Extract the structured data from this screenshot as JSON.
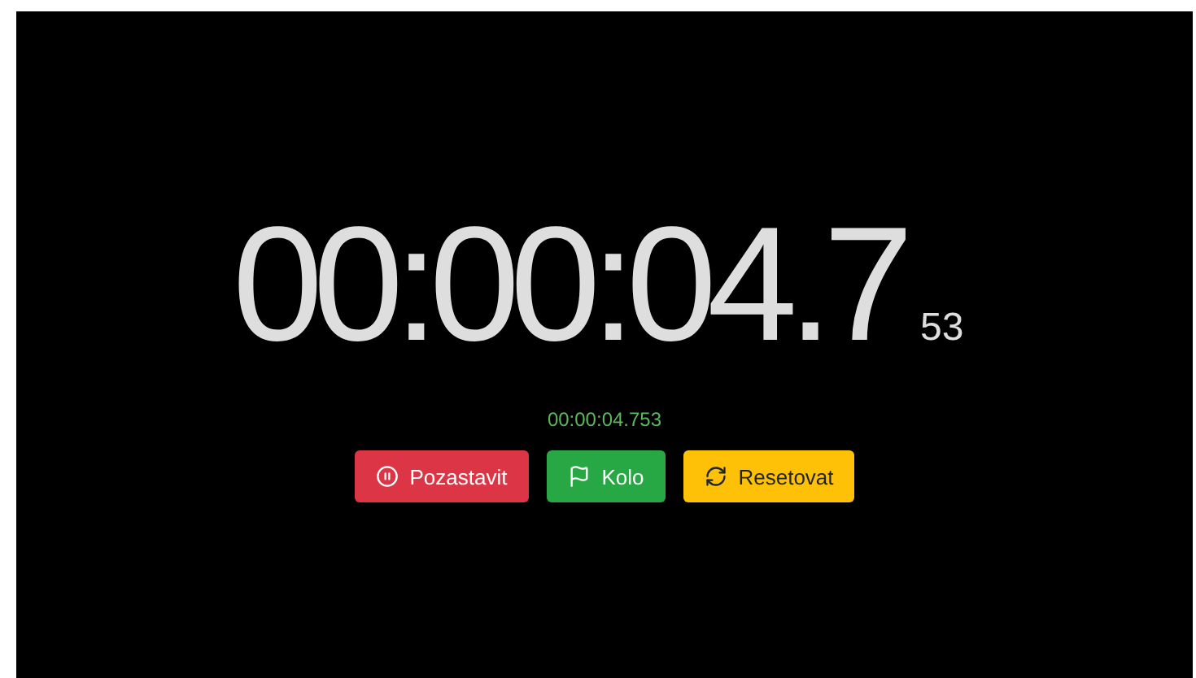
{
  "stopwatch": {
    "main_time": "00:00:04.7",
    "fraction": "53",
    "full_time": "00:00:04.753"
  },
  "buttons": [
    {
      "label": "Pozastavit",
      "kind": "pause",
      "color": "#dc3545"
    },
    {
      "label": "Kolo",
      "kind": "lap",
      "color": "#28a745"
    },
    {
      "label": "Resetovat",
      "kind": "reset",
      "color": "#ffc107"
    }
  ]
}
